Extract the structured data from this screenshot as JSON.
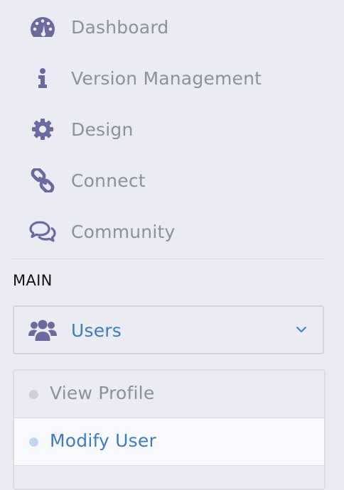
{
  "nav": {
    "items": [
      {
        "label": "Dashboard",
        "icon": "dashboard-gauge-icon"
      },
      {
        "label": "Version Management",
        "icon": "info-icon"
      },
      {
        "label": "Design",
        "icon": "gear-icon"
      },
      {
        "label": "Connect",
        "icon": "link-chain-icon"
      },
      {
        "label": "Community",
        "icon": "chat-bubbles-icon"
      }
    ]
  },
  "section": {
    "title": "MAIN"
  },
  "users_menu": {
    "label": "Users",
    "icon": "users-group-icon",
    "expanded": true,
    "submenu": [
      {
        "label": "View Profile",
        "active": false
      },
      {
        "label": "Modify User",
        "active": true
      }
    ]
  },
  "colors": {
    "background": "#ebebf4",
    "icon": "#6a6a9e",
    "label_muted": "#8d9297",
    "accent": "#3f7ac3"
  }
}
